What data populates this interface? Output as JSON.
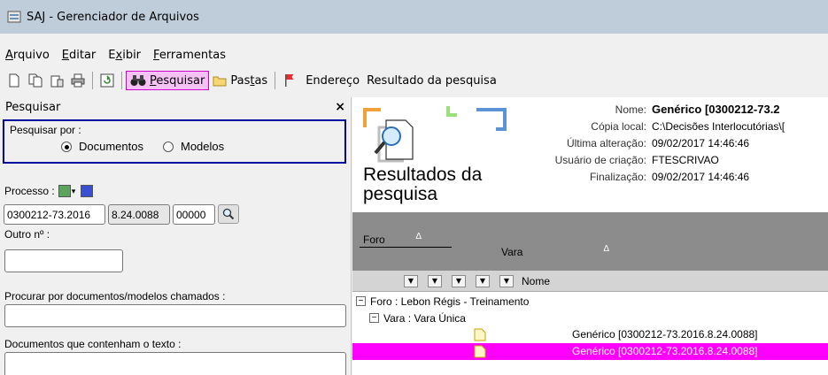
{
  "window": {
    "title": "SAJ - Gerenciador de Arquivos"
  },
  "menu": [
    {
      "label": "Arquivo",
      "mnemonic": "A",
      "rest": "rquivo"
    },
    {
      "label": "Editar",
      "mnemonic": "E",
      "rest": "ditar"
    },
    {
      "label": "Exibir",
      "pre": "E",
      "mnemonic": "x",
      "rest": "ibir"
    },
    {
      "label": "Ferramentas",
      "mnemonic": "F",
      "rest": "erramentas"
    }
  ],
  "toolbar": {
    "search_mnemonic": "P",
    "search_rest": "esquisar",
    "folders_pre": "Pas",
    "folders_mnemonic": "t",
    "folders_rest": "as",
    "address_label": "Endereço",
    "address_value": "Resultado da pesquisa"
  },
  "search_panel": {
    "title": "Pesquisar",
    "close": "×",
    "search_by_label": "Pesquisar por :",
    "option_documents": "Documentos",
    "option_models": "Modelos",
    "selected_option": "Documentos",
    "process_label": "Processo :",
    "process_part1": "0300212-73.2016",
    "process_part2": "8.24.0088",
    "process_part3": "00000",
    "other_number_label": "Outro nº :",
    "other_number_value": "",
    "named_docs_label": "Procurar por documentos/modelos chamados :",
    "named_docs_value": "",
    "containing_text_label": "Documentos que contenham o texto :",
    "containing_text_value": ""
  },
  "results": {
    "title_line1": "Resultados da",
    "title_line2": "pesquisa",
    "meta": {
      "name_label": "Nome:",
      "name_value": "Genérico [0300212-73.2",
      "local_copy_label": "Cópia local:",
      "local_copy_value": "C:\\Decisões Interlocutórias\\[",
      "last_change_label": "Última alteração:",
      "last_change_value": "09/02/2017 14:46:46",
      "creator_label": "Usuário de criação:",
      "creator_value": "FTESCRIVAO",
      "finalization_label": "Finalização:",
      "finalization_value": "09/02/2017 14:46:46"
    },
    "group_by": [
      {
        "label": "Foro",
        "sort_icon": "Δ"
      },
      {
        "label": "Vara",
        "sort_icon": "Δ"
      }
    ],
    "columns": {
      "name_header": "Nome"
    },
    "tree": [
      {
        "level": 0,
        "expander": "−",
        "label": "Foro : Lebon Régis - Treinamento"
      },
      {
        "level": 1,
        "expander": "−",
        "label": "Vara : Vara Única"
      }
    ],
    "documents": [
      {
        "name": "Genérico [0300212-73.2016.8.24.0088]",
        "selected": false
      },
      {
        "name": "Genérico [0300212-73.2016.8.24.0088]",
        "selected": true
      }
    ]
  }
}
